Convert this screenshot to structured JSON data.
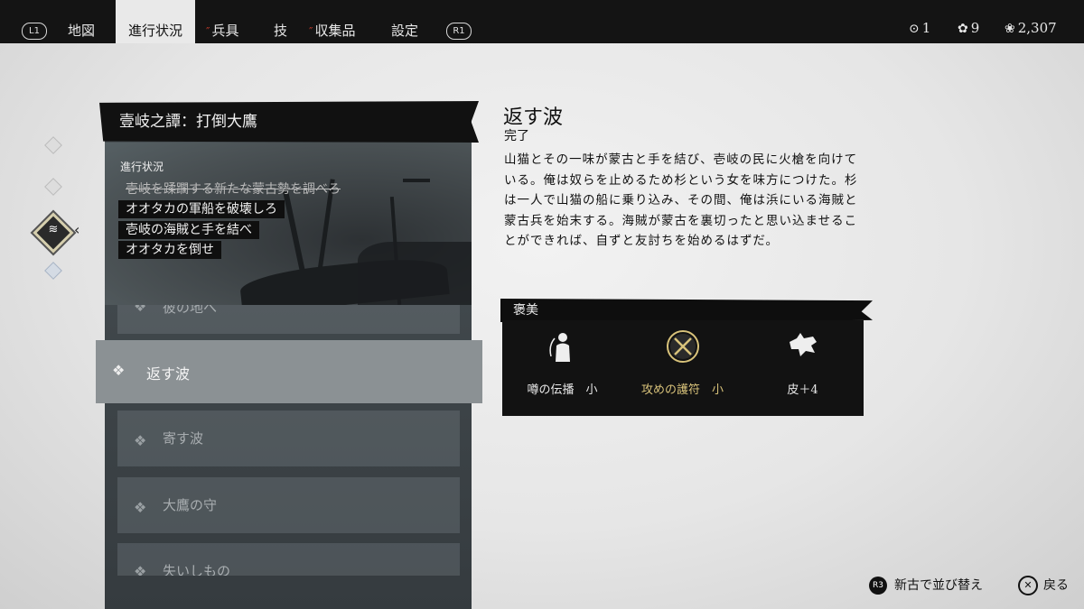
{
  "topbar": {
    "l1": "L1",
    "r1": "R1",
    "tabs": [
      {
        "label": "地図",
        "active": false,
        "marked": false
      },
      {
        "label": "進行状況",
        "active": true,
        "marked": false
      },
      {
        "label": "兵具",
        "active": false,
        "marked": true
      },
      {
        "label": "技",
        "active": false,
        "marked": false
      },
      {
        "label": "収集品",
        "active": false,
        "marked": true
      },
      {
        "label": "設定",
        "active": false,
        "marked": false
      }
    ],
    "currencies": [
      {
        "icon": "technique-point-icon",
        "value": "1"
      },
      {
        "icon": "flower-icon",
        "value": "9"
      },
      {
        "icon": "supplies-icon",
        "value": "2,307"
      }
    ]
  },
  "quest": {
    "header": "壹岐之譚：打倒大鷹",
    "progress_label": "進行状況",
    "objectives": [
      {
        "text": "壱岐を蹂躙する新たな蒙古勢を調べろ",
        "done": true
      },
      {
        "text": "オオタカの軍船を破壊しろ",
        "done": false
      },
      {
        "text": "壱岐の海賊と手を結べ",
        "done": false
      },
      {
        "text": "オオタカを倒せ",
        "done": false
      }
    ],
    "list": [
      {
        "label": "彼の地へ",
        "selected": false
      },
      {
        "label": "返す波",
        "selected": true
      },
      {
        "label": "寄す波",
        "selected": false
      },
      {
        "label": "大鷹の守",
        "selected": false
      },
      {
        "label": "失いしもの",
        "selected": false
      }
    ]
  },
  "detail": {
    "title": "返す波",
    "status": "完了",
    "description": "山猫とその一味が蒙古と手を結び、壱岐の民に火槍を向けている。俺は奴らを止めるため杉という女を味方につけた。杉は一人で山猫の船に乗り込み、その間、俺は浜にいる海賊と蒙古兵を始末する。海賊が蒙古を裏切ったと思い込ませることができれば、自ずと友討ちを始めるはずだ。"
  },
  "rewards": {
    "header": "褒美",
    "items": [
      {
        "icon": "legend-spread-icon",
        "label": "噂の伝播　小"
      },
      {
        "icon": "crossed-swords-charm-icon",
        "label": "攻めの護符　小"
      },
      {
        "icon": "hide-icon",
        "label": "皮＋4"
      }
    ]
  },
  "hints": {
    "sort_button": "R3",
    "sort_label": "新古で並び替え",
    "back_label": "戻る"
  },
  "colors": {
    "topbar_bg": "#141414",
    "panel_bg": "#41484c",
    "reward_gold": "#d8c27a"
  }
}
